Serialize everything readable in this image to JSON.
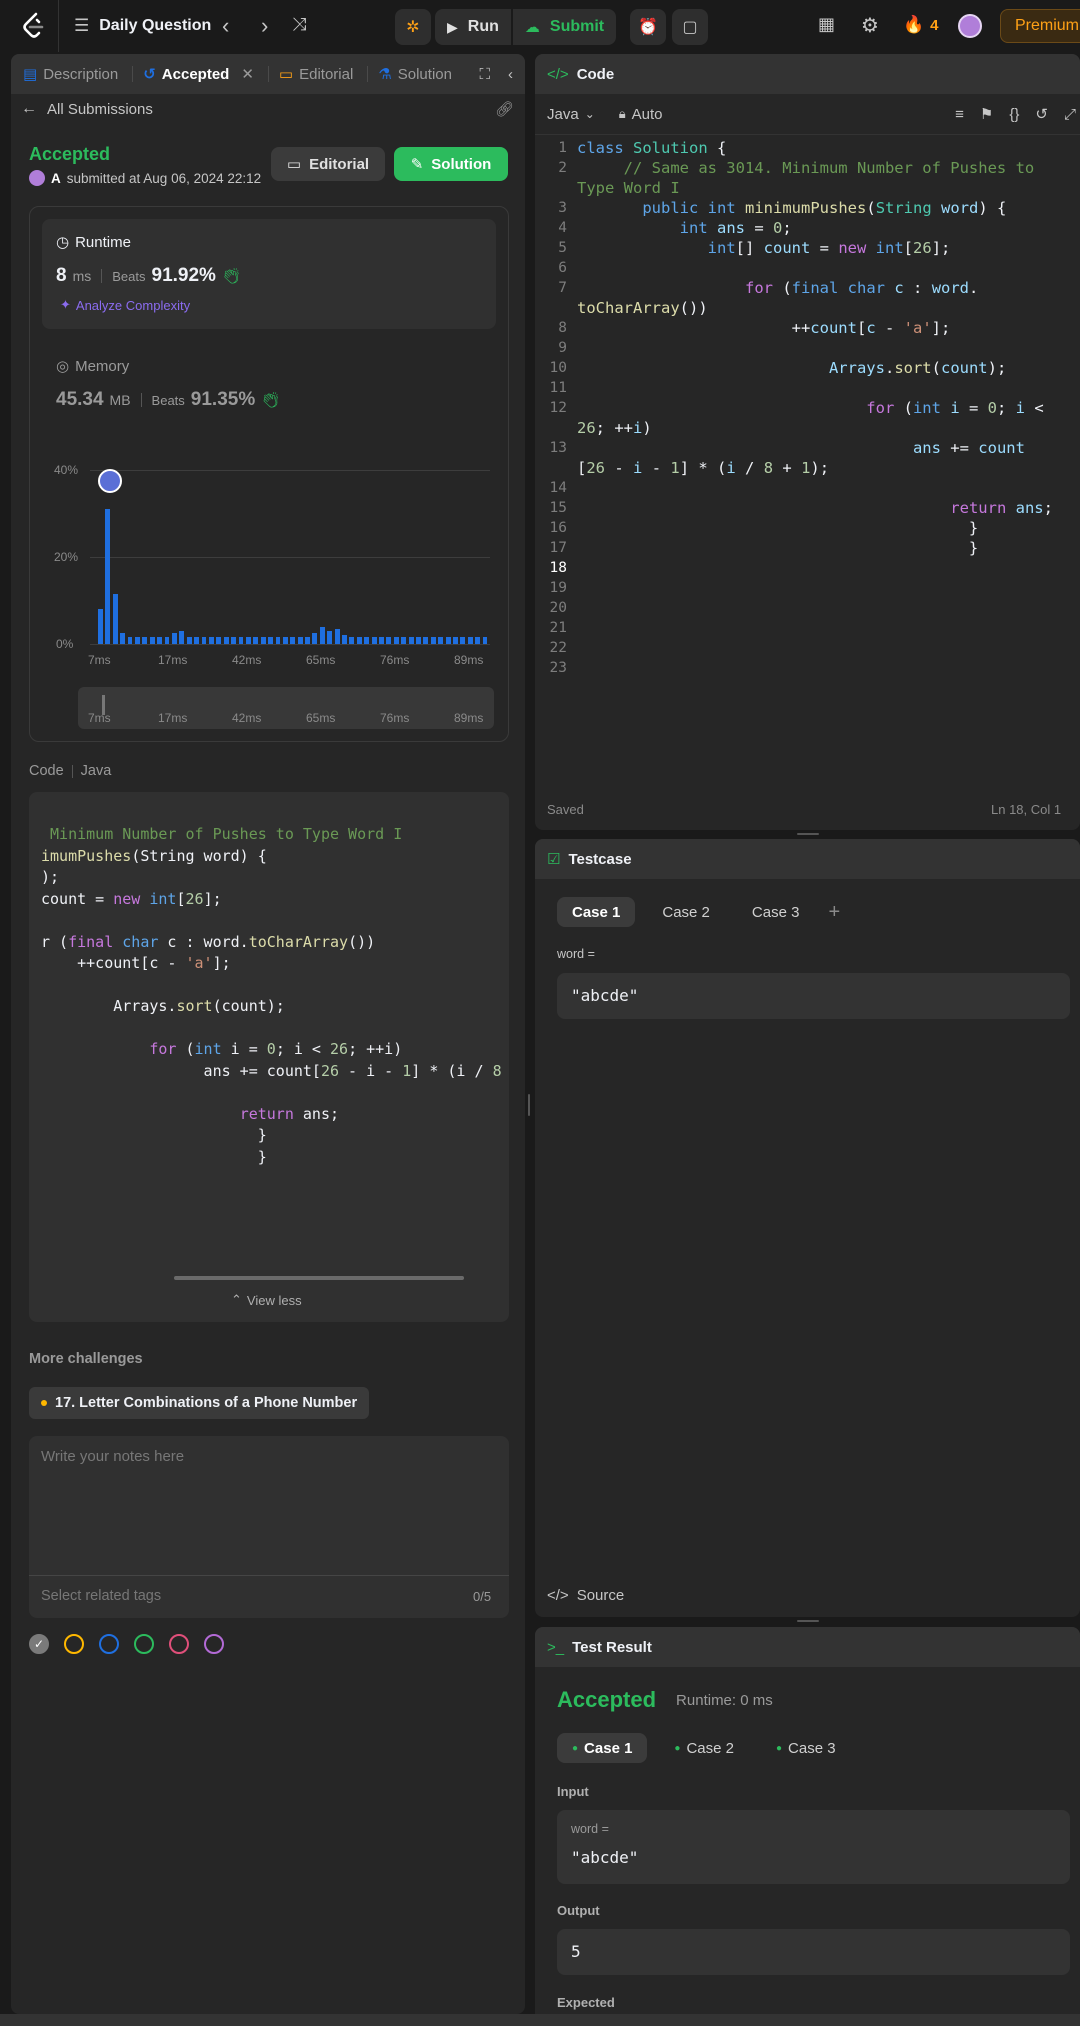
{
  "nav": {
    "title": "Daily Question",
    "run": "Run",
    "submit": "Submit",
    "streak": "4",
    "premium": "Premium"
  },
  "left_tabs": [
    {
      "label": "Description"
    },
    {
      "label": "Accepted"
    },
    {
      "label": "Editorial"
    },
    {
      "label": "Solution"
    }
  ],
  "submission": {
    "back_label": "All Submissions",
    "status": "Accepted",
    "user_initial": "A",
    "submitted_text": "submitted at Aug 06, 2024 22:12",
    "editorial_btn": "Editorial",
    "solution_btn": "Solution",
    "runtime_title": "Runtime",
    "runtime_value": "8",
    "runtime_unit": "ms",
    "beats_label": "Beats",
    "runtime_beats": "91.92%",
    "analyze": "Analyze Complexity",
    "memory_title": "Memory",
    "memory_value": "45.34",
    "memory_unit": "MB",
    "memory_beats": "91.35%"
  },
  "chart_data": {
    "type": "bar",
    "yticks": [
      "40%",
      "20%",
      "0%"
    ],
    "ylim": [
      0,
      40
    ],
    "xticks": [
      "7ms",
      "17ms",
      "42ms",
      "65ms",
      "76ms",
      "89ms"
    ],
    "values": [
      8,
      31,
      11.5,
      2.5,
      1.5,
      1.5,
      1.5,
      1.5,
      1.5,
      1.5,
      2.5,
      3,
      1.5,
      1.5,
      1.5,
      1.5,
      1.5,
      1.5,
      1.5,
      1.5,
      1.5,
      1.5,
      1.5,
      1.5,
      1.5,
      1.5,
      1.5,
      1.5,
      1.5,
      2.5,
      4,
      3,
      3.5,
      2,
      1.5,
      1.5,
      1.5,
      1.5,
      1.5,
      1.5,
      1.5,
      1.5,
      1.5,
      1.5,
      1.5,
      1.5,
      1.5,
      1.5,
      1.5,
      1.5,
      1.5,
      1.5,
      1.5
    ],
    "grid": true
  },
  "code_section": {
    "label": "Code",
    "lang": "Java",
    "lines": [
      " Minimum Number of Pushes to Type Word I",
      "imumPushes(String word) {",
      ");",
      "count = new int[26];",
      "",
      "r (final char c : word.toCharArray())",
      "    ++count[c - 'a'];",
      "",
      "        Arrays.sort(count);",
      "",
      "            for (int i = 0; i < 26; ++i)",
      "                  ans += count[26 - i - 1] * (i / 8",
      "",
      "                      return ans;",
      "                        }",
      "                        }"
    ],
    "view_less": "View less"
  },
  "more": {
    "title": "More challenges",
    "item": "17. Letter Combinations of a Phone Number",
    "notes_placeholder": "Write your notes here",
    "tags_placeholder": "Select related tags",
    "tags_count": "0/5"
  },
  "code_panel": {
    "title": "Code",
    "lang": "Java",
    "mode": "Auto",
    "saved": "Saved",
    "position": "Ln 18, Col 1"
  },
  "testcase": {
    "title": "Testcase",
    "cases": [
      "Case 1",
      "Case 2",
      "Case 3"
    ],
    "var_label": "word =",
    "value": "\"abcde\"",
    "source": "Source"
  },
  "result": {
    "title": "Test Result",
    "status": "Accepted",
    "runtime": "Runtime: 0 ms",
    "cases": [
      "Case 1",
      "Case 2",
      "Case 3"
    ],
    "input_label": "Input",
    "var_label": "word =",
    "input_value": "\"abcde\"",
    "output_label": "Output",
    "output_value": "5",
    "expected_label": "Expected"
  },
  "colors": {
    "accent_green": "#2cbb5d",
    "bar_blue": "#1f6fe0",
    "tag_circles": [
      "#7a7a7a",
      "#ffb800",
      "#1f6fe0",
      "#2cbb5d",
      "#e04f7a",
      "#b36ad6"
    ]
  }
}
